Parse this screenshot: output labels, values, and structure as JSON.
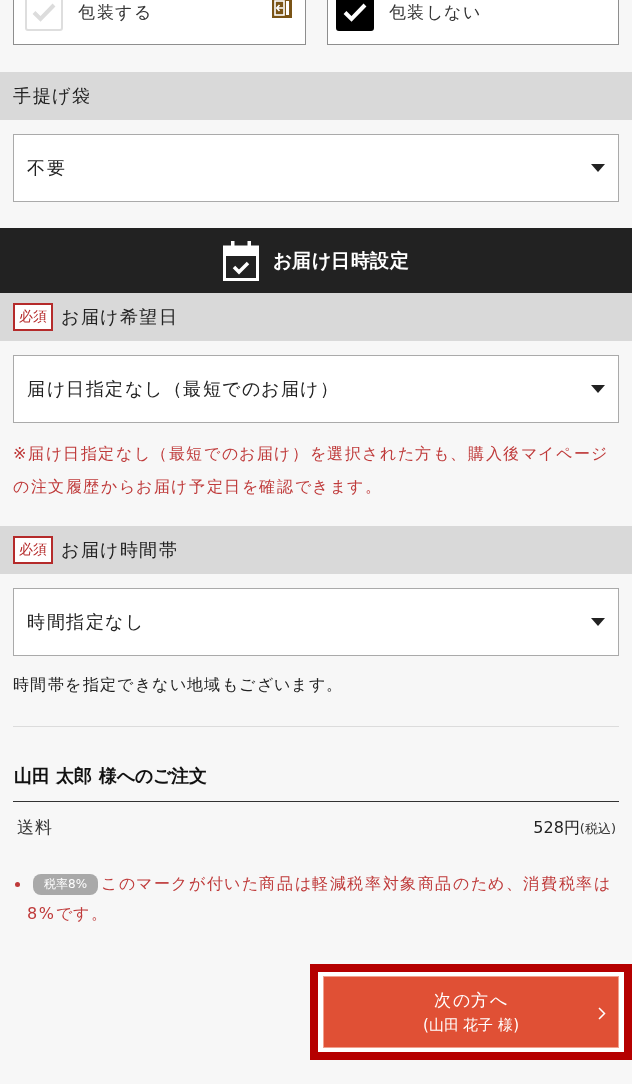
{
  "wrapping": {
    "options": [
      {
        "label": "包装する",
        "selected": false,
        "side_icon": true
      },
      {
        "label": "包装しない",
        "selected": true,
        "side_icon": false
      }
    ]
  },
  "gift_bag": {
    "heading": "手提げ袋",
    "dropdown": {
      "value": "不要"
    }
  },
  "delivery": {
    "banner": "お届け日時設定",
    "fields": [
      {
        "badge": "必須",
        "heading": "お届け希望日",
        "dropdown": {
          "value": "届け日指定なし（最短でのお届け）"
        },
        "note": {
          "kind": "alert",
          "text": "※届け日指定なし（最短でのお届け）を選択された方も、購入後マイページの注文履歴からお届け予定日を確認できます。"
        }
      },
      {
        "badge": "必須",
        "heading": "お届け時間帯",
        "dropdown": {
          "value": "時間指定なし"
        },
        "note": {
          "kind": "plain",
          "text": "時間帯を指定できない地域もございます。"
        }
      }
    ]
  },
  "order": {
    "title": "山田 太郎 様へのご注文",
    "rows": [
      {
        "label": "送料",
        "amount": "528円",
        "tax_note": "(税込)"
      }
    ],
    "notes": [
      {
        "badge": "税率8%",
        "text": "このマークが付いた商品は軽減税率対象商品のため、消費税率は8%です。"
      }
    ]
  },
  "next_button": {
    "label": "次の方へ",
    "sublabel": "(山田 花子 様)",
    "highlighted": true
  }
}
